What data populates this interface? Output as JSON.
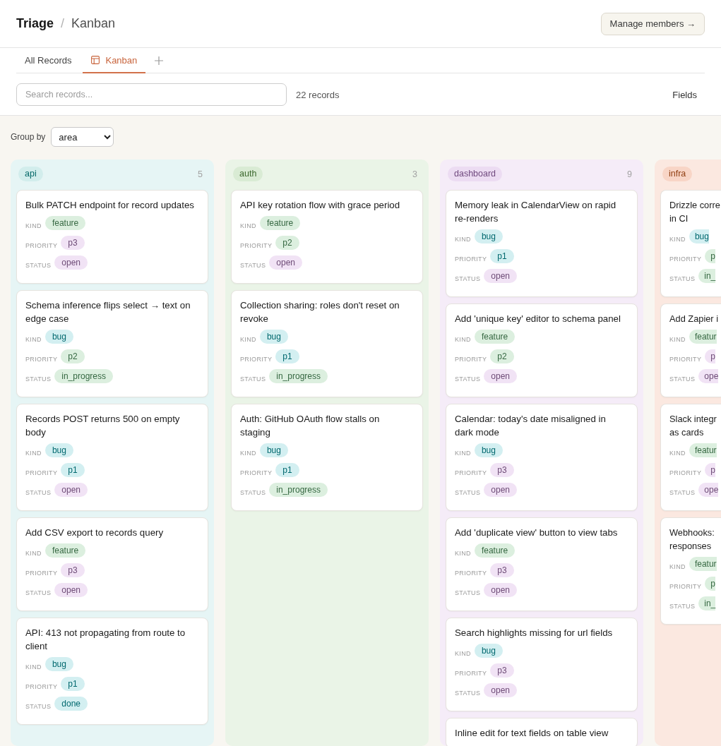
{
  "breadcrumb": {
    "title": "Triage",
    "separator": "/",
    "current": "Kanban"
  },
  "manage_button": "Manage members →",
  "tabs": [
    {
      "label": "All Records",
      "kind": "list",
      "selected": false
    },
    {
      "label": "Kanban",
      "kind": "kanban",
      "selected": true
    }
  ],
  "toolbar": {
    "search": {
      "placeholder": "Search records..."
    },
    "record_count": "22 records",
    "fields_button": "Fields"
  },
  "group_by": {
    "label": "Group by",
    "value": "area"
  },
  "columns": [
    {
      "name": "api",
      "count": "5",
      "color": "#d2edec",
      "cards": [
        {
          "title": "Bulk PATCH endpoint for record updates",
          "fields": [
            {
              "label": "KIND",
              "value": "feature",
              "color": "#dcefdf"
            },
            {
              "label": "PRIORITY",
              "value": "p3",
              "color": "#f1e3f5"
            },
            {
              "label": "STATUS",
              "value": "open",
              "color": "#f1e3f5"
            }
          ]
        },
        {
          "title": "Schema inference flips select → text on\nedge case",
          "fields": [
            {
              "label": "KIND",
              "value": "bug",
              "color": "#d3eff1"
            },
            {
              "label": "PRIORITY",
              "value": "p2",
              "color": "#dcefdf"
            },
            {
              "label": "STATUS",
              "value": "in_progress",
              "color": "#dcefdf"
            }
          ]
        },
        {
          "title": "Records POST returns 500 on empty\nbody",
          "fields": [
            {
              "label": "KIND",
              "value": "bug",
              "color": "#d3eff1"
            },
            {
              "label": "PRIORITY",
              "value": "p1",
              "color": "#d3eff1"
            },
            {
              "label": "STATUS",
              "value": "open",
              "color": "#f1e3f5"
            }
          ]
        },
        {
          "title": "Add CSV export to records query",
          "fields": [
            {
              "label": "KIND",
              "value": "feature",
              "color": "#dcefdf"
            },
            {
              "label": "PRIORITY",
              "value": "p3",
              "color": "#f1e3f5"
            },
            {
              "label": "STATUS",
              "value": "open",
              "color": "#f1e3f5"
            }
          ]
        },
        {
          "title": "API: 413 not propagating from route to\nclient",
          "fields": [
            {
              "label": "KIND",
              "value": "bug",
              "color": "#d3eff1"
            },
            {
              "label": "PRIORITY",
              "value": "p1",
              "color": "#d3eff1"
            },
            {
              "label": "STATUS",
              "value": "done",
              "color": "#d3eff1"
            }
          ]
        }
      ]
    },
    {
      "name": "auth",
      "count": "3",
      "color": "#d9ebd4",
      "cards": [
        {
          "title": "API key rotation flow with grace period",
          "fields": [
            {
              "label": "KIND",
              "value": "feature",
              "color": "#dcefdf"
            },
            {
              "label": "PRIORITY",
              "value": "p2",
              "color": "#dcefdf"
            },
            {
              "label": "STATUS",
              "value": "open",
              "color": "#f1e3f5"
            }
          ]
        },
        {
          "title": "Collection sharing: roles don't reset on\nrevoke",
          "fields": [
            {
              "label": "KIND",
              "value": "bug",
              "color": "#d3eff1"
            },
            {
              "label": "PRIORITY",
              "value": "p1",
              "color": "#d3eff1"
            },
            {
              "label": "STATUS",
              "value": "in_progress",
              "color": "#dcefdf"
            }
          ]
        },
        {
          "title": "Auth: GitHub OAuth flow stalls on\nstaging",
          "fields": [
            {
              "label": "KIND",
              "value": "bug",
              "color": "#d3eff1"
            },
            {
              "label": "PRIORITY",
              "value": "p1",
              "color": "#d3eff1"
            },
            {
              "label": "STATUS",
              "value": "in_progress",
              "color": "#dcefdf"
            }
          ]
        }
      ]
    },
    {
      "name": "dashboard",
      "count": "9",
      "color": "#ecdcf2",
      "cards": [
        {
          "title": "Memory leak in CalendarView on rapid\nre-renders",
          "fields": [
            {
              "label": "KIND",
              "value": "bug",
              "color": "#d3eff1"
            },
            {
              "label": "PRIORITY",
              "value": "p1",
              "color": "#d3eff1"
            },
            {
              "label": "STATUS",
              "value": "open",
              "color": "#f1e3f5"
            }
          ]
        },
        {
          "title": "Add 'unique key' editor to schema panel",
          "fields": [
            {
              "label": "KIND",
              "value": "feature",
              "color": "#dcefdf"
            },
            {
              "label": "PRIORITY",
              "value": "p2",
              "color": "#dcefdf"
            },
            {
              "label": "STATUS",
              "value": "open",
              "color": "#f1e3f5"
            }
          ]
        },
        {
          "title": "Calendar: today's date misaligned in\ndark mode",
          "fields": [
            {
              "label": "KIND",
              "value": "bug",
              "color": "#d3eff1"
            },
            {
              "label": "PRIORITY",
              "value": "p3",
              "color": "#f1e3f5"
            },
            {
              "label": "STATUS",
              "value": "open",
              "color": "#f1e3f5"
            }
          ]
        },
        {
          "title": "Add 'duplicate view' button to view tabs",
          "fields": [
            {
              "label": "KIND",
              "value": "feature",
              "color": "#dcefdf"
            },
            {
              "label": "PRIORITY",
              "value": "p3",
              "color": "#f1e3f5"
            },
            {
              "label": "STATUS",
              "value": "open",
              "color": "#f1e3f5"
            }
          ]
        },
        {
          "title": "Search highlights missing for url fields",
          "fields": [
            {
              "label": "KIND",
              "value": "bug",
              "color": "#d3eff1"
            },
            {
              "label": "PRIORITY",
              "value": "p3",
              "color": "#f1e3f5"
            },
            {
              "label": "STATUS",
              "value": "open",
              "color": "#f1e3f5"
            }
          ]
        },
        {
          "title": "Inline edit for text fields on table view"
        }
      ]
    },
    {
      "name": "infra",
      "color": "#f8d5c6",
      "cards": [
        {
          "title": "Drizzle corre\nin CI",
          "fields": [
            {
              "label": "KIND",
              "value": "bug",
              "color": "#d3eff1"
            },
            {
              "label": "PRIORITY",
              "value": "p",
              "color": "#dcefdf"
            },
            {
              "label": "STATUS",
              "value": "in_",
              "color": "#dcefdf"
            }
          ]
        },
        {
          "title": "Add Zapier i",
          "fields": [
            {
              "label": "KIND",
              "value": "featur",
              "color": "#dcefdf"
            },
            {
              "label": "PRIORITY",
              "value": "p",
              "color": "#f1e3f5"
            },
            {
              "label": "STATUS",
              "value": "ope",
              "color": "#f1e3f5"
            }
          ]
        },
        {
          "title": "Slack integr\nas cards",
          "fields": [
            {
              "label": "KIND",
              "value": "featur",
              "color": "#dcefdf"
            },
            {
              "label": "PRIORITY",
              "value": "p",
              "color": "#f1e3f5"
            },
            {
              "label": "STATUS",
              "value": "ope",
              "color": "#f1e3f5"
            }
          ]
        },
        {
          "title": "Webhooks:\nresponses",
          "fields": [
            {
              "label": "KIND",
              "value": "featur",
              "color": "#dcefdf"
            },
            {
              "label": "PRIORITY",
              "value": "p",
              "color": "#dcefdf"
            },
            {
              "label": "STATUS",
              "value": "in_",
              "color": "#dcefdf"
            }
          ]
        }
      ]
    }
  ]
}
